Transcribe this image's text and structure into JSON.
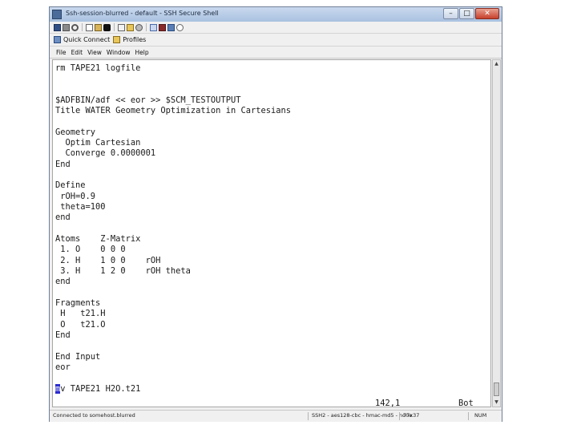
{
  "window": {
    "title": "Ssh-session-blurred - default - SSH Secure Shell"
  },
  "titlebar_controls": {
    "minimize": "–",
    "maximize": "□",
    "close": "✕"
  },
  "toolbar_icons": [
    "save-icon",
    "print-icon",
    "search-icon",
    "copy-icon",
    "paste-icon",
    "find-icon",
    "new-file-icon",
    "folder-icon",
    "settings-icon",
    "help-icon",
    "key-icon",
    "tools-icon",
    "info-icon"
  ],
  "linkbar": {
    "quick_connect": "Quick Connect",
    "profiles": "Profiles"
  },
  "menu": [
    "File",
    "Edit",
    "View",
    "Window",
    "Help"
  ],
  "terminal": {
    "lines": [
      "rm TAPE21 logfile",
      "",
      "",
      "$ADFBIN/adf << eor >> $SCM_TESTOUTPUT",
      "Title WATER Geometry Optimization in Cartesians",
      "",
      "Geometry",
      "  Optim Cartesian",
      "  Converge 0.0000001",
      "End",
      "",
      "Define",
      " rOH=0.9",
      " theta=100",
      "end",
      "",
      "Atoms    Z-Matrix",
      " 1. O    0 0 0",
      " 2. H    1 0 0    rOH",
      " 3. H    1 2 0    rOH theta",
      "end",
      "",
      "Fragments",
      " H   t21.H",
      " O   t21.O",
      "End",
      "",
      "End Input",
      "eor",
      ""
    ],
    "last_line_cursor": "m",
    "last_line_rest": "v TAPE21 H2O.t21",
    "position": "142,1",
    "scroll_state": "Bot"
  },
  "statusbar": {
    "connection": "Connected to somehost.blurred",
    "encryption": "SSH2 - aes128-cbc - hmac-md5 - none",
    "size": "77x37",
    "num": "NUM"
  }
}
